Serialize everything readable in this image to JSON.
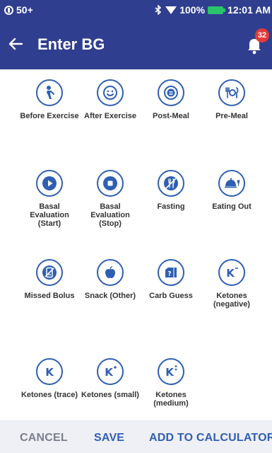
{
  "status_bar": {
    "notification_count": "50+",
    "battery_percent": "100%",
    "time": "12:01 AM"
  },
  "header": {
    "title": "Enter BG",
    "notification_badge": "32"
  },
  "tags": [
    {
      "label": "Before Exercise",
      "icon": "before-exercise-icon"
    },
    {
      "label": "After Exercise",
      "icon": "after-exercise-icon"
    },
    {
      "label": "Post-Meal",
      "icon": "post-meal-icon"
    },
    {
      "label": "Pre-Meal",
      "icon": "pre-meal-icon"
    },
    {
      "label": "Basal Evaluation (Start)",
      "icon": "play-icon"
    },
    {
      "label": "Basal Evaluation (Stop)",
      "icon": "stop-icon"
    },
    {
      "label": "Fasting",
      "icon": "fasting-icon"
    },
    {
      "label": "Eating Out",
      "icon": "cloche-icon"
    },
    {
      "label": "Missed Bolus",
      "icon": "missed-bolus-icon"
    },
    {
      "label": "Snack (Other)",
      "icon": "apple-icon"
    },
    {
      "label": "Carb Guess",
      "icon": "carb-guess-icon"
    },
    {
      "label": "Ketones (negative)",
      "icon": "ketones-negative-icon"
    },
    {
      "label": "Ketones (trace)",
      "icon": "ketones-trace-icon"
    },
    {
      "label": "Ketones (small)",
      "icon": "ketones-small-icon"
    },
    {
      "label": "Ketones (medium)",
      "icon": "ketones-medium-icon"
    }
  ],
  "footer": {
    "cancel": "CANCEL",
    "save": "SAVE",
    "add_to_calculator": "ADD TO CALCULATOR"
  },
  "colors": {
    "primary": "#2f3e8e",
    "accent": "#2f5fb3",
    "badge": "#e23b3b",
    "battery": "#29c46a"
  }
}
